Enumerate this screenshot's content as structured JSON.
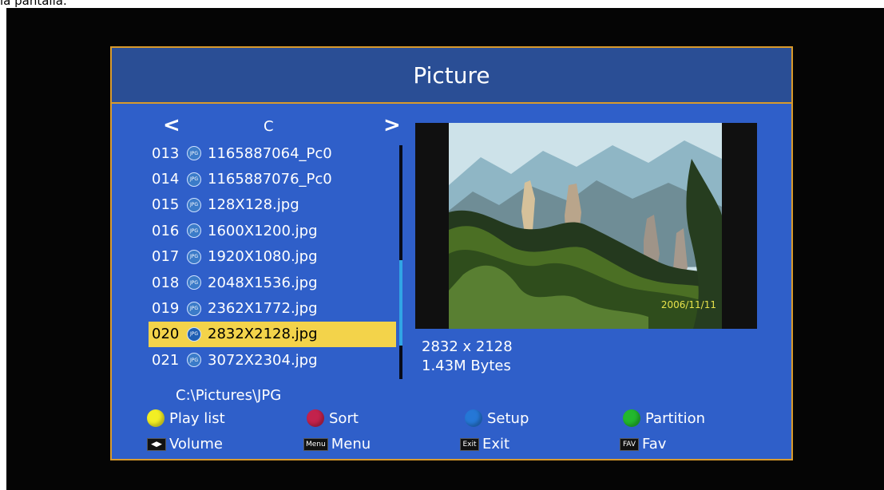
{
  "top_caption": "la pantalla.",
  "window": {
    "title": "Picture"
  },
  "browser": {
    "drive": "C",
    "nav_left": "<",
    "nav_right": ">",
    "items": [
      {
        "num": "013",
        "icon": "JPG",
        "name": "1165887064_Pc0"
      },
      {
        "num": "014",
        "icon": "JPG",
        "name": "1165887076_Pc0"
      },
      {
        "num": "015",
        "icon": "JPG",
        "name": "128X128.jpg"
      },
      {
        "num": "016",
        "icon": "JPG",
        "name": "1600X1200.jpg"
      },
      {
        "num": "017",
        "icon": "JPG",
        "name": "1920X1080.jpg"
      },
      {
        "num": "018",
        "icon": "JPG",
        "name": "2048X1536.jpg"
      },
      {
        "num": "019",
        "icon": "JPG",
        "name": "2362X1772.jpg"
      },
      {
        "num": "020",
        "icon": "JPG",
        "name": "2832X2128.jpg"
      },
      {
        "num": "021",
        "icon": "JPG",
        "name": "3072X2304.jpg"
      }
    ],
    "path": "C:\\Pictures\\JPG"
  },
  "preview": {
    "date_stamp": "2006/11/11"
  },
  "image_info": {
    "dimensions": "2832 x 2128",
    "size": "1.43M Bytes"
  },
  "legend": {
    "play_list": "Play list",
    "sort": "Sort",
    "setup": "Setup",
    "partition": "Partition",
    "volume_key": "◀▶",
    "volume": "Volume",
    "menu_key": "Menu",
    "menu": "Menu",
    "exit_key": "Exit",
    "exit": "Exit",
    "fav_key": "FAV",
    "fav": "Fav"
  },
  "colors": {
    "accent_border": "#d99a2b",
    "panel_blue": "#2f5fc9",
    "selected_row": "#f3d34a",
    "yellow_button": "#f2ee24",
    "red_button": "#c3224c",
    "blue_button": "#2577d6",
    "green_button": "#22b82d"
  }
}
